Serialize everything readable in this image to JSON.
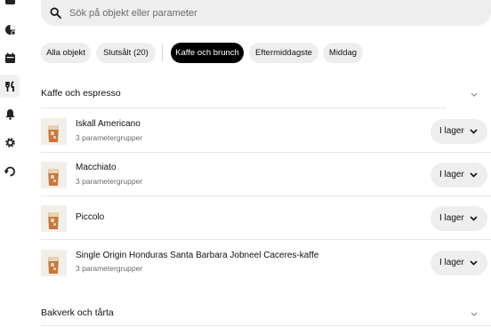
{
  "search": {
    "placeholder": "Sök på objekt eller parameter"
  },
  "nav": {
    "icons": [
      "store-icon",
      "pie-chart-icon",
      "calendar-icon",
      "menu-fork-knife-icon",
      "bell-icon",
      "gear-icon",
      "refresh-icon"
    ],
    "active": "menu-fork-knife-icon"
  },
  "filters": [
    {
      "label": "Alla objekt"
    },
    {
      "label": "Slutsålt (20)"
    },
    {
      "label": "Kaffe och brunch",
      "active": true
    },
    {
      "label": "Eftermiddagste"
    },
    {
      "label": "Middag"
    }
  ],
  "sections": [
    {
      "title": "Kaffe och espresso",
      "items": [
        {
          "name": "Iskall Americano",
          "subtitle": "3 parametergrupper",
          "status": "I lager"
        },
        {
          "name": "Macchiato",
          "subtitle": "3 parametergrupper",
          "status": "I lager"
        },
        {
          "name": "Piccolo",
          "subtitle": "",
          "status": "I lager"
        },
        {
          "name": "Single Origin Honduras Santa Barbara Jobneel Caceres-kaffe",
          "subtitle": "3 parametergrupper",
          "status": "I lager"
        }
      ]
    },
    {
      "title": "Bakverk och tårta",
      "items": []
    }
  ],
  "colors": {
    "active_chip": "#000000",
    "chip_bg": "#eeeeee",
    "muted_text": "#6b6b6b"
  }
}
